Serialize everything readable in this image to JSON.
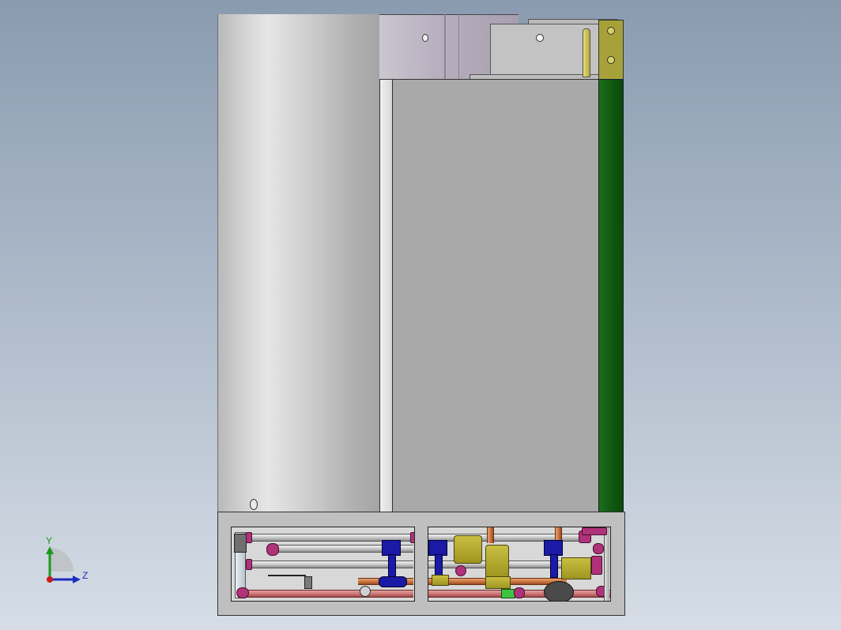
{
  "viewport": {
    "model": "water-heater-cabinet-assembly",
    "view_orientation": "side-view"
  },
  "triad": {
    "y_label": "Y",
    "z_label": "Z",
    "y_color": "#1a9a1a",
    "z_color": "#1b2ec0",
    "x_color": "#cc1a1a"
  },
  "colors": {
    "background_top": "#8a9bb0",
    "background_bottom": "#d6dde6",
    "panel": "#a9a9a9",
    "green_strip": "#0e560e",
    "pipe_copper": "#c5703c",
    "valve_blue": "#1a1aa6",
    "fitting_magenta": "#b0327a",
    "brass": "#b0a82e"
  }
}
